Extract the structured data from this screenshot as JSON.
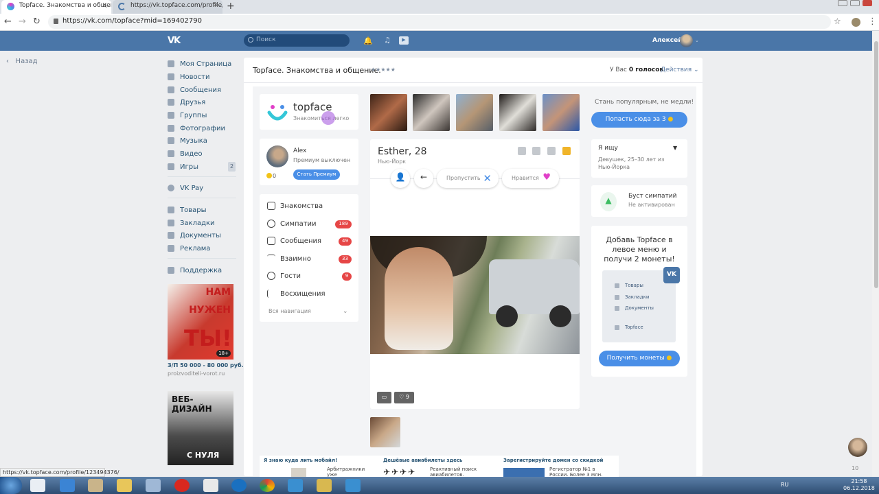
{
  "browser": {
    "tabs": [
      {
        "label": "Topface. Знакомства и общение"
      },
      {
        "label": "https://vk.topface.com/profile/12"
      }
    ],
    "url": "https://vk.com/topface?mid=169402790",
    "status_url": "https://vk.topface.com/profile/123494376/"
  },
  "vk": {
    "logo": "VK",
    "search_placeholder": "Поиск",
    "user_name": "Алексей",
    "back_label": "Назад",
    "menu": [
      {
        "label": "Моя Страница",
        "icon": "home-icon"
      },
      {
        "label": "Новости",
        "icon": "news-icon"
      },
      {
        "label": "Сообщения",
        "icon": "messages-icon"
      },
      {
        "label": "Друзья",
        "icon": "friends-icon"
      },
      {
        "label": "Группы",
        "icon": "groups-icon"
      },
      {
        "label": "Фотографии",
        "icon": "camera-icon"
      },
      {
        "label": "Музыка",
        "icon": "music-icon"
      },
      {
        "label": "Видео",
        "icon": "video-icon"
      },
      {
        "label": "Игры",
        "icon": "games-icon",
        "badge": "2"
      },
      {
        "label": "VK Pay",
        "icon": "vkpay-icon"
      },
      {
        "label": "Товары",
        "icon": "shop-icon"
      },
      {
        "label": "Закладки",
        "icon": "star-icon"
      },
      {
        "label": "Документы",
        "icon": "document-icon"
      },
      {
        "label": "Реклама",
        "icon": "ads-icon"
      },
      {
        "label": "Поддержка",
        "icon": "support-icon"
      }
    ],
    "ad1": {
      "line1": "НАМ",
      "line2": "НУЖЕН",
      "line3": "ТЫ!",
      "age": "18+",
      "caption": "З/П 50 000 - 80 000 руб.",
      "link": "proizvoditeli-vorot.ru"
    },
    "ad2": {
      "line1": "ВЕБ-ДИЗАЙН",
      "line2": "С НУЛЯ"
    }
  },
  "app": {
    "title": "Topface. Знакомства и общение.",
    "stars": "★★★★★",
    "votes_prefix": "У Вас",
    "votes_count": "0 голосов",
    "actions_label": "Действия",
    "brand": "topface",
    "brand_tagline": "Знакомиться легко",
    "user": {
      "name": "Alex",
      "status": "Премиум выключен",
      "coins": "0",
      "premium_button": "Стать Премиум"
    },
    "nav": [
      {
        "label": "Знакомства"
      },
      {
        "label": "Симпатии",
        "badge": "189"
      },
      {
        "label": "Сообщения",
        "badge": "49"
      },
      {
        "label": "Взаимно",
        "badge": "33"
      },
      {
        "label": "Гости",
        "badge": "9"
      },
      {
        "label": "Восхищения"
      }
    ],
    "all_nav": "Вся навигация",
    "profile": {
      "name": "Esther, 28",
      "city": "Нью-Йорк",
      "skip_label": "Пропустить",
      "like_label": "Нравится",
      "likes": "9"
    },
    "popular_text": "Стань популярным, не медли!",
    "get_here_button": "Попасть сюда за 3",
    "looking": {
      "title": "Я ищу",
      "desc": "Девушек, 25–30 лет  из Нью-Йорка"
    },
    "boost": {
      "title": "Буст симпатий",
      "status": "Не активирован"
    },
    "add_menu": {
      "title": "Добавь Topface в левое меню и получи 2 монеты!",
      "items": [
        "Товары",
        "Закладки",
        "Документы",
        "Topface"
      ],
      "button": "Получить монеты"
    }
  },
  "ads_row": [
    {
      "title": "Я знаю куда лить мобайл!",
      "text": "Арбитражники уже зарабатывают, а ты что"
    },
    {
      "title": "Дешёвые авиабилеты здесь",
      "text": "Реактивный поиск авиабилетов. Онлайн-"
    },
    {
      "title": "Зарегистрируйте домен со скидкой",
      "text": "Регистратор №1 в России. Более 3 млн. доменов на"
    }
  ],
  "float_count": "10",
  "taskbar": {
    "lang": "RU",
    "time": "21:58",
    "date": "06.12.2018"
  },
  "colors": {
    "vk_blue": "#4a76a8",
    "accent_blue": "#4a8fe7",
    "badge_red": "#e64646"
  }
}
